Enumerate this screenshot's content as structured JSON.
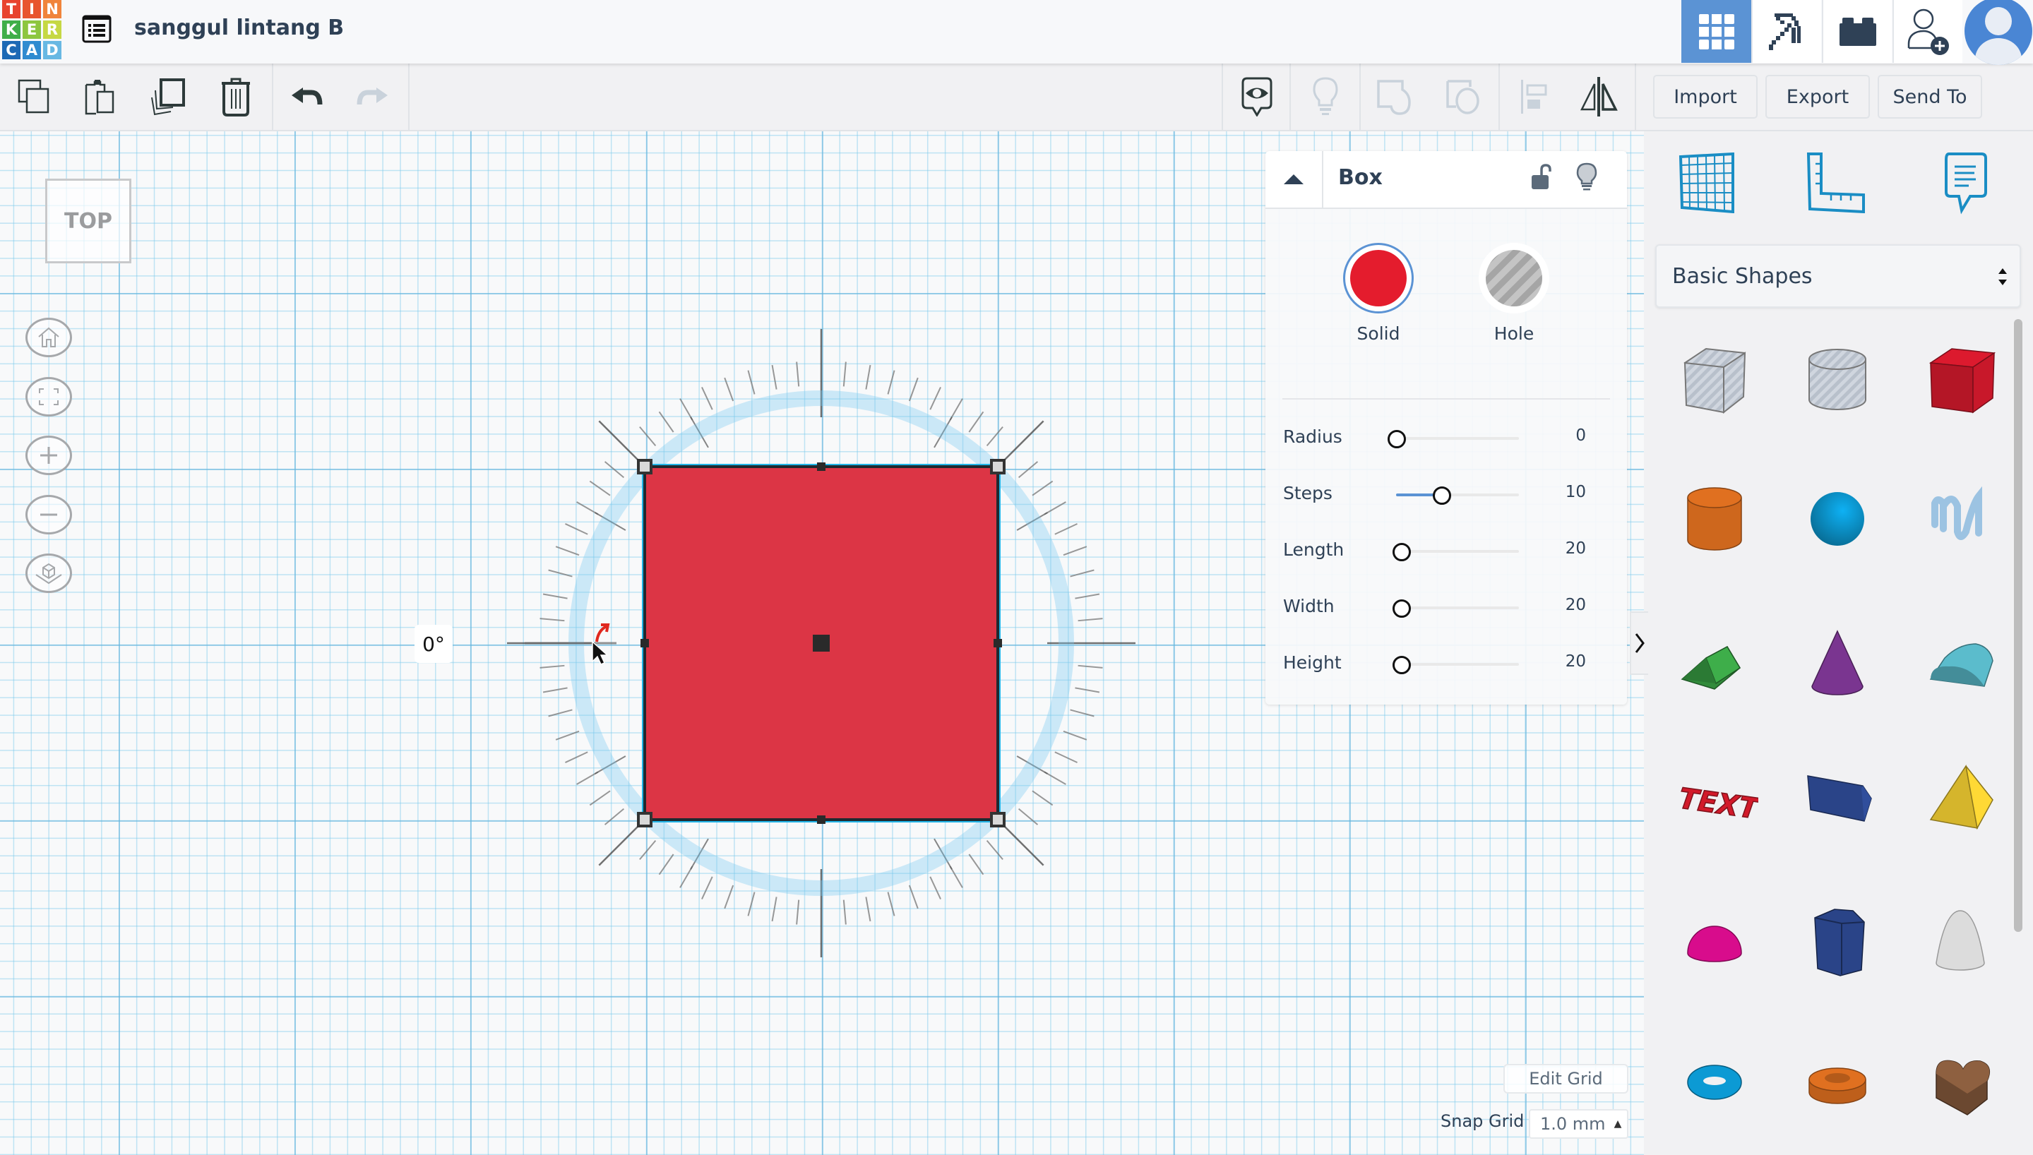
{
  "header": {
    "logo_letters": [
      "T",
      "I",
      "N",
      "K",
      "E",
      "R",
      "C",
      "A",
      "D"
    ],
    "logo_colors": [
      "#e8432f",
      "#e8552e",
      "#f0843b",
      "#3fae49",
      "#8dc63f",
      "#c6d843",
      "#1d69b5",
      "#2f8bd0",
      "#68b8e3"
    ],
    "design_title": "sanggul lintang B",
    "buttons": [
      {
        "name": "3d-design",
        "icon": "grid-icon",
        "active": true
      },
      {
        "name": "minecraft",
        "icon": "pickaxe-icon",
        "active": false
      },
      {
        "name": "lego-bricks",
        "icon": "brick-icon",
        "active": false
      },
      {
        "name": "invite-user",
        "icon": "add-user-icon",
        "active": false
      },
      {
        "name": "profile",
        "icon": "avatar-icon",
        "active": false
      }
    ]
  },
  "toolbar": {
    "copy": "copy-icon",
    "paste": "paste-icon",
    "duplicate": "duplicate-icon",
    "delete": "trash-icon",
    "undo": "undo-icon",
    "redo": "redo-icon",
    "notes": "notes-visibility-icon",
    "show_all": "lightbulb-icon",
    "group": "group-icon",
    "ungroup": "ungroup-icon",
    "align": "align-icon",
    "mirror": "mirror-icon",
    "import_label": "Import",
    "export_label": "Export",
    "send_to_label": "Send To"
  },
  "canvas": {
    "view_cube_label": "TOP",
    "nav": [
      "home-view-icon",
      "fit-view-icon",
      "zoom-in-icon",
      "zoom-out-icon",
      "perspective-icon"
    ],
    "rotation_angle": "0°",
    "selected_shape_color": "#dc3545",
    "edit_grid_label": "Edit Grid",
    "snap_grid_label": "Snap Grid",
    "snap_grid_value": "1.0 mm"
  },
  "inspector": {
    "shape_name": "Box",
    "solid_label": "Solid",
    "hole_label": "Hole",
    "solid_color": "#e41c2d",
    "selected_mode": "Solid",
    "params": [
      {
        "label": "Radius",
        "value": "0",
        "fraction": 0.0
      },
      {
        "label": "Steps",
        "value": "10",
        "fraction": 0.37
      },
      {
        "label": "Length",
        "value": "20",
        "fraction": 0.04
      },
      {
        "label": "Width",
        "value": "20",
        "fraction": 0.04
      },
      {
        "label": "Height",
        "value": "20",
        "fraction": 0.04
      }
    ]
  },
  "library": {
    "tools": [
      "workplane-icon",
      "ruler-icon",
      "note-icon"
    ],
    "category": "Basic Shapes",
    "shapes": [
      {
        "name": "box-hole",
        "color": "#c5ccd6"
      },
      {
        "name": "cylinder-hole",
        "color": "#c5ccd6"
      },
      {
        "name": "box",
        "color": "#c8182a"
      },
      {
        "name": "cylinder",
        "color": "#e07020"
      },
      {
        "name": "sphere",
        "color": "#0c9ad4"
      },
      {
        "name": "scribble",
        "color": "#9cc3e2"
      },
      {
        "name": "roof",
        "color": "#3eae4a"
      },
      {
        "name": "cone",
        "color": "#7a3590"
      },
      {
        "name": "round-roof",
        "color": "#5bbccc"
      },
      {
        "name": "text",
        "color": "#d21a2a"
      },
      {
        "name": "wedge",
        "color": "#2a4488"
      },
      {
        "name": "pyramid",
        "color": "#e8c530"
      },
      {
        "name": "half-sphere",
        "color": "#d80c8c"
      },
      {
        "name": "polygon",
        "color": "#2a4488"
      },
      {
        "name": "paraboloid",
        "color": "#dcdcdc"
      },
      {
        "name": "torus",
        "color": "#0c9ad4"
      },
      {
        "name": "tube",
        "color": "#e07020"
      },
      {
        "name": "heart",
        "color": "#8e6040"
      }
    ]
  }
}
